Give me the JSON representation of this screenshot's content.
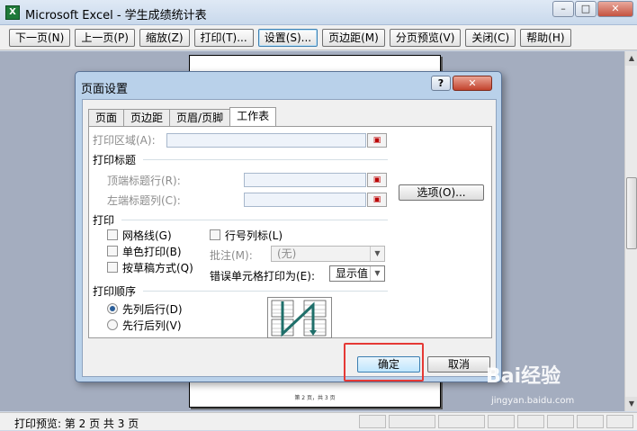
{
  "window": {
    "title": "Microsoft Excel - 学生成绩统计表",
    "minimize": "–",
    "maximize": "□",
    "close": "✕"
  },
  "toolbar": {
    "buttons": [
      "下一页(N)",
      "上一页(P)",
      "缩放(Z)",
      "打印(T)...",
      "设置(S)...",
      "页边距(M)",
      "分页预览(V)",
      "关闭(C)",
      "帮助(H)"
    ]
  },
  "preview": {
    "footer": "第 2 页，共 3 页"
  },
  "status": {
    "text": "打印预览: 第 2 页  共 3 页"
  },
  "dialog": {
    "title": "页面设置",
    "help": "?",
    "close": "✕",
    "tabs": [
      "页面",
      "页边距",
      "页眉/页脚",
      "工作表"
    ],
    "selected_tab": "工作表",
    "print_area_label": "打印区域(A):",
    "print_titles_label": "打印标题",
    "rows_repeat_label": "顶端标题行(R):",
    "cols_repeat_label": "左端标题列(C):",
    "options_button": "选项(O)...",
    "print_label": "打印",
    "gridlines": "网格线(G)",
    "black_white": "单色打印(B)",
    "draft": "按草稿方式(Q)",
    "row_col_headings": "行号列标(L)",
    "comments_label": "批注(M):",
    "comments_value": "(无)",
    "cell_errors_label": "错误单元格打印为(E):",
    "cell_errors_value": "显示值",
    "page_order_label": "打印顺序",
    "down_then_over": "先列后行(D)",
    "over_then_down": "先行后列(V)",
    "ok": "确定",
    "cancel": "取消"
  },
  "watermark": {
    "text": "Bai经验",
    "sub": "jingyan.baidu.com"
  }
}
